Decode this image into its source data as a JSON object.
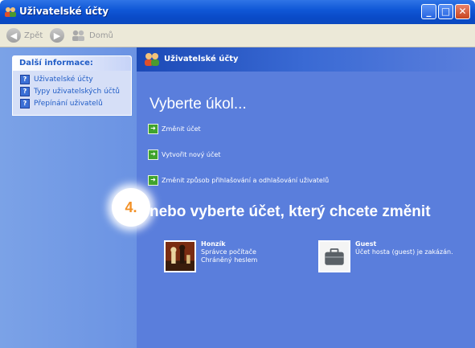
{
  "window": {
    "title": "Uživatelské účty"
  },
  "toolbar": {
    "back_label": "Zpět",
    "home_label": "Domů"
  },
  "sidebar": {
    "heading": "Další informace:",
    "links": [
      {
        "label": "Uživatelské účty"
      },
      {
        "label": "Typy uživatelských účtů"
      },
      {
        "label": "Přepínání uživatelů"
      }
    ]
  },
  "main": {
    "header_title": "Uživatelské účty",
    "pick_task": "Vyberte úkol...",
    "tasks": [
      {
        "label": "Změnit účet"
      },
      {
        "label": "Vytvořit nový účet"
      },
      {
        "label": "Změnit způsob přihlašování a odhlašování uživatelů"
      }
    ],
    "or_pick_account": "nebo vyberte účet, který chcete změnit",
    "accounts": [
      {
        "name": "Honzík",
        "line1": "Správce počítače",
        "line2": "Chráněný heslem"
      },
      {
        "name": "Guest",
        "line1": "Účet hosta (guest) je zakázán.",
        "line2": ""
      }
    ]
  },
  "annotation": {
    "step": "4."
  }
}
